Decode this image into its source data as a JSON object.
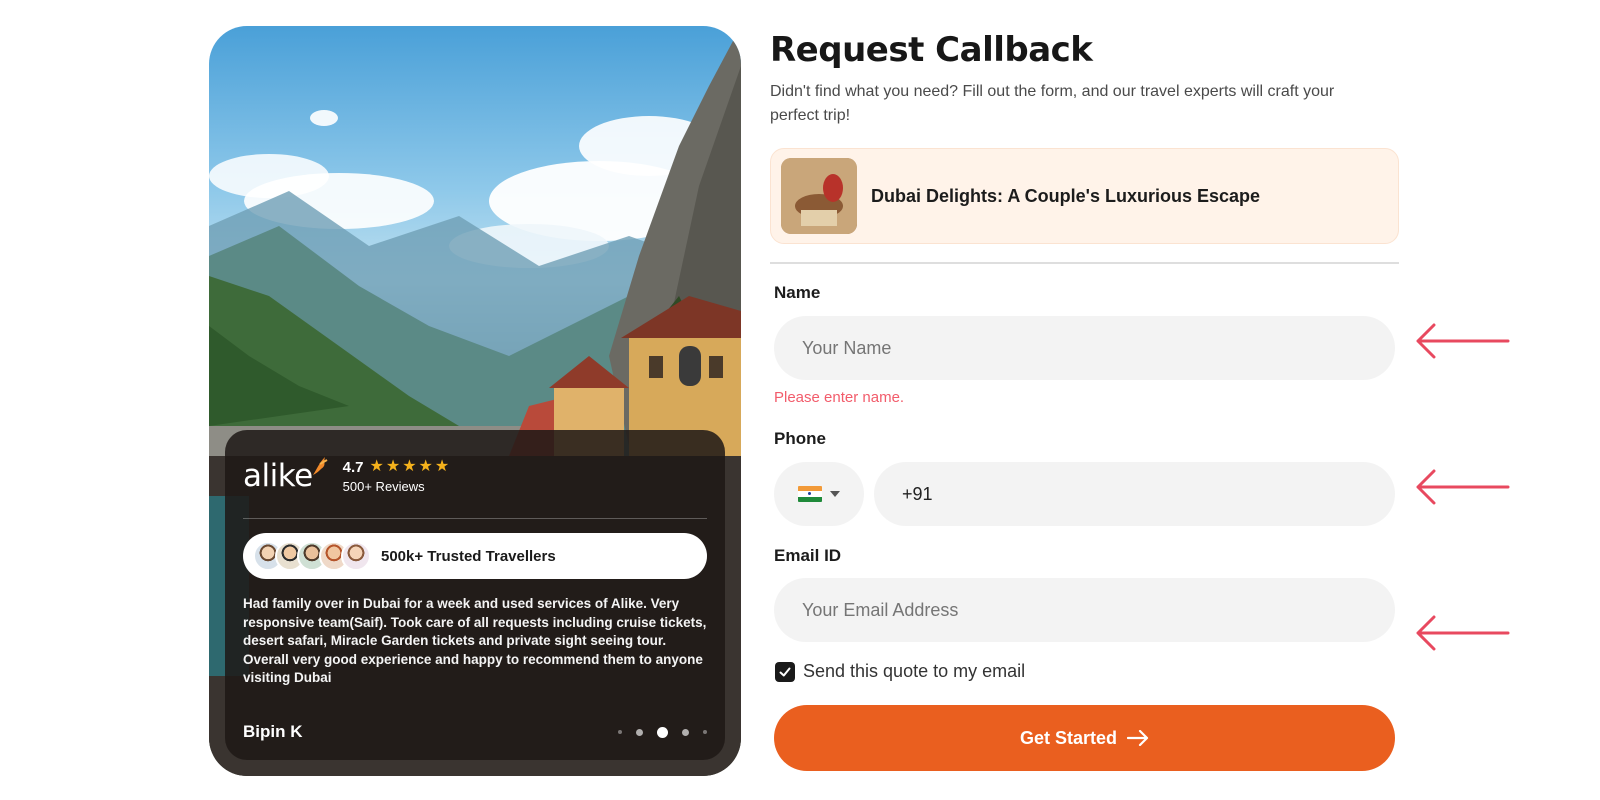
{
  "review_card": {
    "brand": "alike",
    "rating": "4.7",
    "stars": 5,
    "reviews_count": "500+ Reviews",
    "trust_label": "500k+ Trusted Travellers",
    "review_text": "Had family over in Dubai for a week and used services of Alike. Very responsive team(Saif). Took care of all requests including cruise tickets, desert safari, Miracle Garden tickets and private sight seeing tour. Overall very good experience and happy to recommend them to anyone visiting Dubai",
    "reviewer": "Bipin K",
    "carousel_active_index": 2,
    "carousel_count": 5
  },
  "form": {
    "title": "Request Callback",
    "subtitle": "Didn't find what you need? Fill out the form, and our travel experts will craft your perfect trip!",
    "package_title": "Dubai Delights: A Couple's Luxurious Escape",
    "name_label": "Name",
    "name_placeholder": "Your Name",
    "name_error": "Please enter name.",
    "phone_label": "Phone",
    "phone_country": "India",
    "phone_value": "+91",
    "email_label": "Email ID",
    "email_placeholder": "Your Email Address",
    "send_quote_label": "Send this quote to my email",
    "send_quote_checked": true,
    "submit_label": "Get Started"
  },
  "colors": {
    "accent": "#ea5f1f",
    "error": "#f25c6b",
    "annotation_arrow": "#e8495f",
    "star": "#f5b21c"
  }
}
